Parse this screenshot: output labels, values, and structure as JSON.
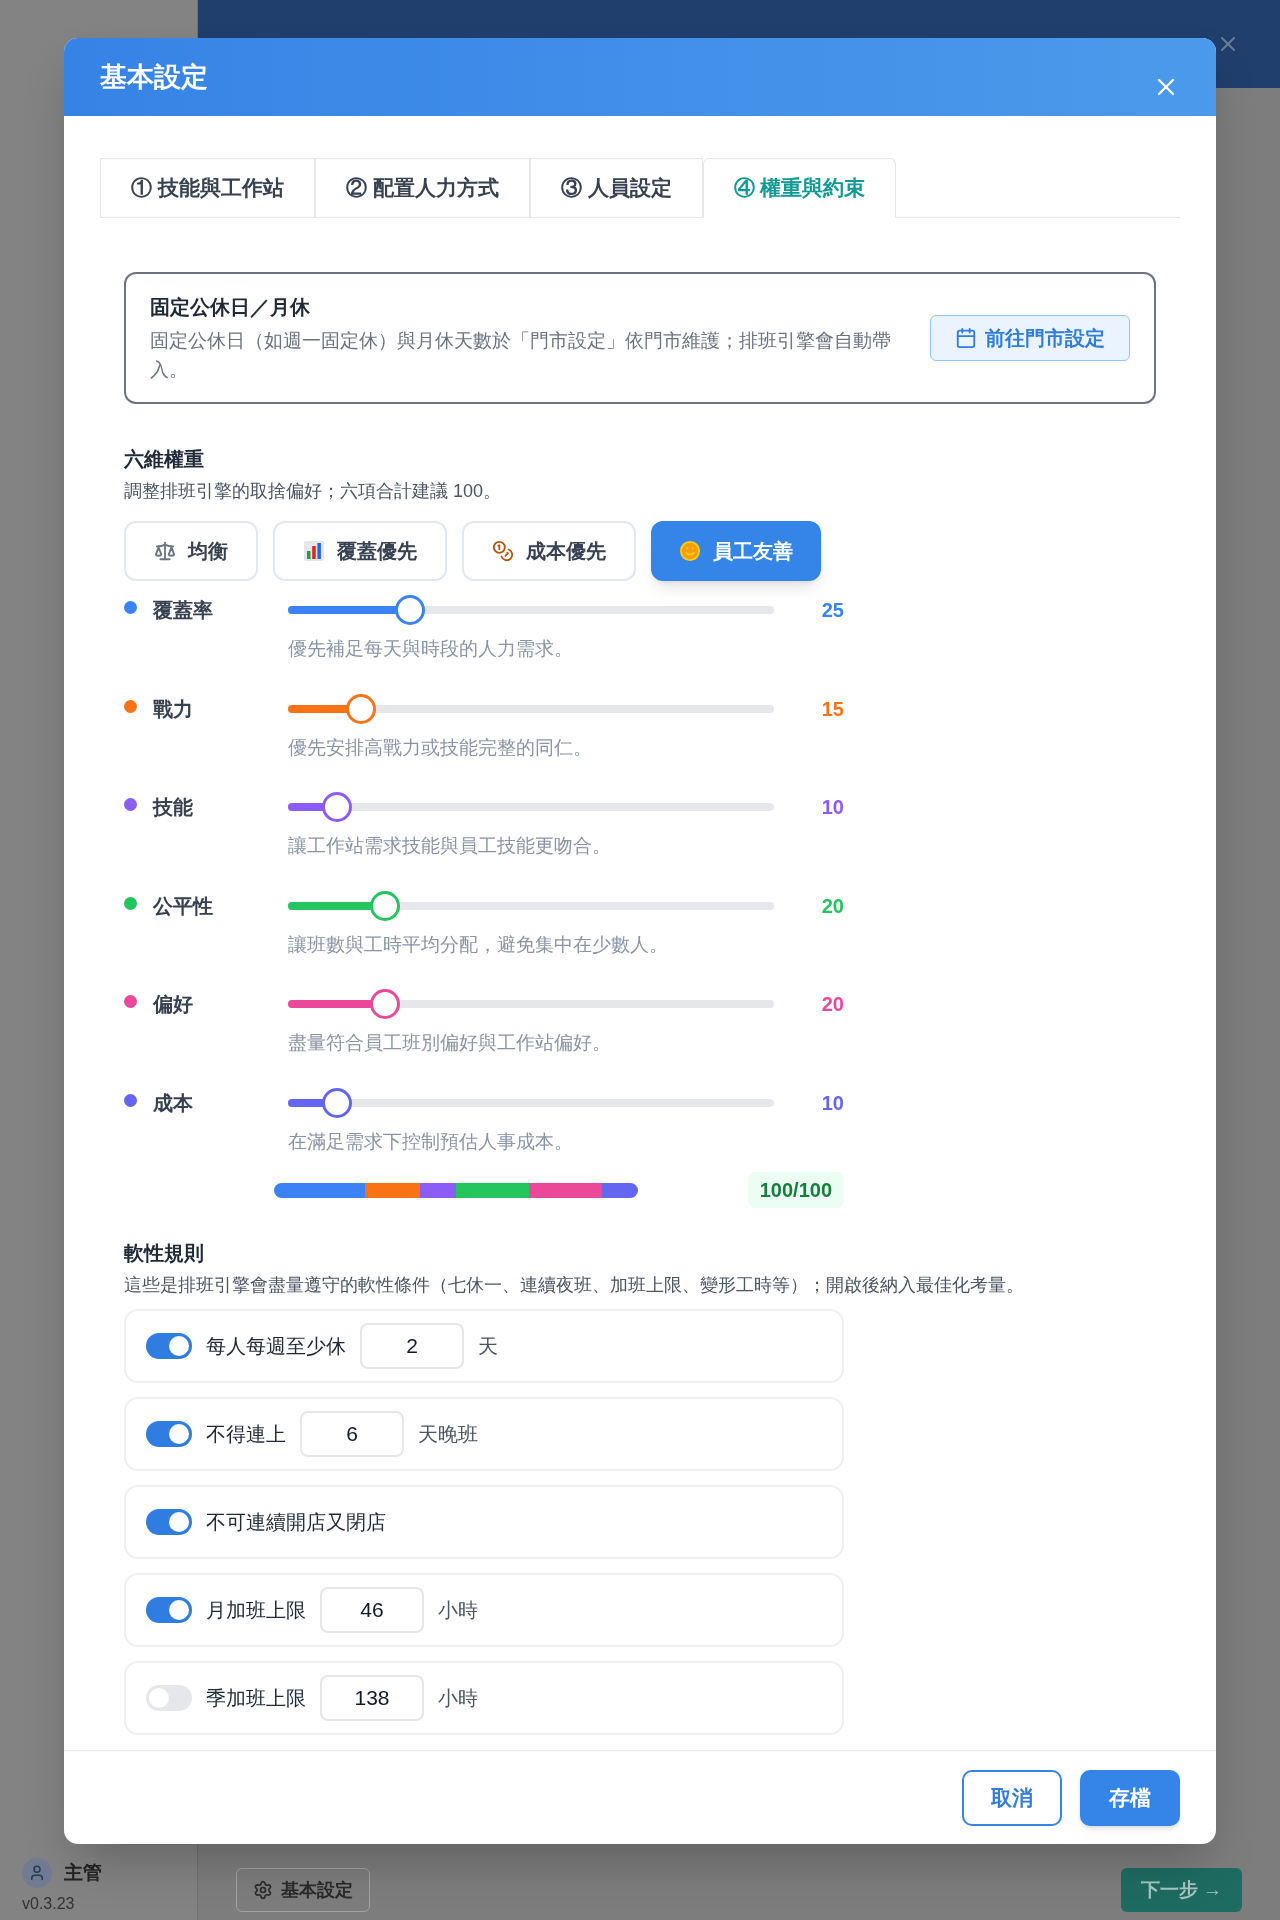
{
  "background": {
    "user": {
      "name": "主管"
    },
    "version": "v0.3.23",
    "settings_button": "基本設定",
    "next_button": "下一步 →"
  },
  "dialog": {
    "title": "基本設定",
    "tabs": [
      {
        "label": "① 技能與工作站",
        "selected": false
      },
      {
        "label": "② 配置人力方式",
        "selected": false
      },
      {
        "label": "③ 人員設定",
        "selected": false
      },
      {
        "label": "④ 權重與約束",
        "selected": true
      }
    ],
    "notice": {
      "title": "固定公休日／月休",
      "text": "固定公休日（如週一固定休）與月休天數於「門市設定」依門市維護；排班引擎會自動帶入。",
      "button": "前往門市設定"
    },
    "weights": {
      "title": "六維權重",
      "description": "調整排班引擎的取捨偏好；六項合計建議 100。",
      "presets": [
        {
          "label": "均衡",
          "selected": false
        },
        {
          "label": "覆蓋優先",
          "selected": false
        },
        {
          "label": "成本優先",
          "selected": false
        },
        {
          "label": "員工友善",
          "selected": true
        }
      ],
      "items": [
        {
          "name": "覆蓋率",
          "color": "#3b82f6",
          "level": 0.25,
          "value": "25",
          "description": "優先補足每天與時段的人力需求。"
        },
        {
          "name": "戰力",
          "color": "#f97316",
          "level": 0.15,
          "value": "15",
          "description": "優先安排高戰力或技能完整的同仁。"
        },
        {
          "name": "技能",
          "color": "#8b5cf6",
          "level": 0.1,
          "value": "10",
          "description": "讓工作站需求技能與員工技能更吻合。"
        },
        {
          "name": "公平性",
          "color": "#22c55e",
          "level": 0.2,
          "value": "20",
          "description": "讓班數與工時平均分配，避免集中在少數人。"
        },
        {
          "name": "偏好",
          "color": "#ec4899",
          "level": 0.2,
          "value": "20",
          "description": "盡量符合員工班別偏好與工作站偏好。"
        },
        {
          "name": "成本",
          "color": "#6366f1",
          "level": 0.1,
          "value": "10",
          "description": "在滿足需求下控制預估人事成本。"
        }
      ],
      "total": "100/100"
    },
    "soft_rules": {
      "title": "軟性規則",
      "description": "這些是排班引擎會盡量遵守的軟性條件（七休一、連續夜班、加班上限、變形工時等）；開啟後納入最佳化考量。",
      "rules": [
        {
          "kind": "input",
          "label": "每人每週至少休",
          "value": "2",
          "unit": "天",
          "on": true
        },
        {
          "kind": "input",
          "label": "不得連上",
          "value": "6",
          "unit": "天晚班",
          "on": true
        },
        {
          "kind": "toggle",
          "label": "不可連續開店又閉店",
          "on": true
        },
        {
          "kind": "input",
          "label": "月加班上限",
          "value": "46",
          "unit": "小時",
          "on": true
        },
        {
          "kind": "input",
          "label": "季加班上限",
          "value": "138",
          "unit": "小時",
          "on": false
        }
      ]
    },
    "buttons": {
      "cancel": "取消",
      "save": "存檔"
    }
  }
}
